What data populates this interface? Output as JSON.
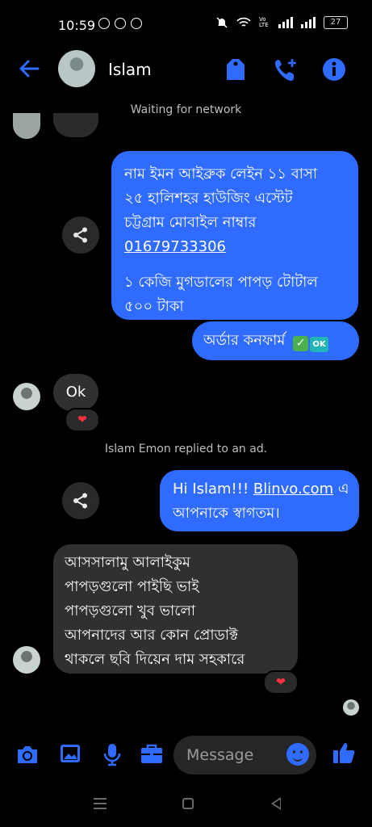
{
  "status": {
    "time": "10:59",
    "battery": "27",
    "network_type": "Vo LTE"
  },
  "header": {
    "contact_name": "Islam",
    "network_status": "Waiting for network"
  },
  "messages": {
    "msg1_lines": [
      "নাম ইমন আইব্রুক লেইন ১১ বাসা",
      "২৫ হালিশহর হাউজিং এস্টেট",
      "চট্টগ্রাম মোবাইল নাম্বার",
      "01679733306",
      "১ কেজি মুগডালের পাপড় টোটাল",
      "৫০০ টাকা"
    ],
    "msg2_text": "অর্ডার কনফার্ম",
    "msg2_check": "✓",
    "msg2_ok": "OK",
    "ok_reply": "Ok",
    "reaction": "❤",
    "system_line": "Islam Emon replied to an ad.",
    "msg3_greeting": "Hi Islam!!! ",
    "msg3_link": "Blinvo.com",
    "msg3_after_link": " এ",
    "msg3_line2": "আপনাকে স্বাগতম।",
    "msg4_lines": [
      "আসসালামু আলাইকুম",
      "পাপড়গুলো পাইছি ভাই",
      "পাপড়গুলো খুব ভালো",
      "আপনাদের আর কোন প্রোডাক্ট",
      "থাকলে ছবি দিয়েন দাম সহকারে"
    ]
  },
  "composer": {
    "placeholder": "Message"
  },
  "colors": {
    "accent": "#2f6bff",
    "incoming_bubble": "#303030",
    "background": "#000000"
  },
  "icons": [
    "back-arrow-icon",
    "tag-icon",
    "phone-add-icon",
    "info-icon",
    "share-icon",
    "camera-icon",
    "gallery-icon",
    "mic-icon",
    "briefcase-icon",
    "emoji-icon",
    "thumbs-up-icon"
  ]
}
